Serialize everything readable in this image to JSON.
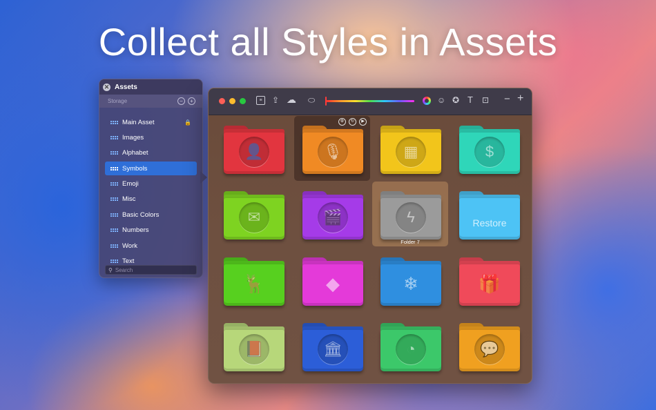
{
  "headline": "Collect all Styles in Assets",
  "assets_panel": {
    "title": "Assets",
    "storage_label": "Storage",
    "items": [
      {
        "label": "Main Asset",
        "locked": true
      },
      {
        "label": "Images"
      },
      {
        "label": "Alphabet"
      },
      {
        "label": "Symbols",
        "selected": true
      },
      {
        "label": "Emoji"
      },
      {
        "label": "Misc"
      },
      {
        "label": "Basic Colors"
      },
      {
        "label": "Numbers"
      },
      {
        "label": "Work"
      },
      {
        "label": "Text"
      }
    ],
    "search_placeholder": "Search"
  },
  "toolbar": {
    "icons": [
      "notes-icon",
      "share-icon",
      "cloud-icon",
      "tag-icon",
      "hue-slider",
      "color-wheel-icon",
      "emoji-icon",
      "star-icon",
      "text-icon",
      "image-icon",
      "minus-icon",
      "plus-icon"
    ]
  },
  "colors": {
    "accent": "#2f6fd8",
    "traffic_red": "#ff5f57",
    "traffic_yellow": "#febc2e",
    "traffic_green": "#28c840"
  },
  "folders": [
    {
      "color": "#e2353f",
      "icon": "person-icon",
      "glyph": "👤"
    },
    {
      "color": "#f08a24",
      "icon": "microphone-icon",
      "glyph": "🎙",
      "hover": true
    },
    {
      "color": "#f2c51b",
      "icon": "phone-booth-icon",
      "glyph": "▦"
    },
    {
      "color": "#2fd6b9",
      "icon": "money-icon",
      "glyph": "$"
    },
    {
      "color": "#7ed321",
      "icon": "mail-icon",
      "glyph": "✉"
    },
    {
      "color": "#a53be8",
      "icon": "clapperboard-icon",
      "glyph": "🎬"
    },
    {
      "color": "#9b9b9b",
      "icon": "lightning-icon",
      "glyph": "ϟ",
      "selected": true,
      "caption": "Folder 7"
    },
    {
      "color": "#4dc3f5",
      "icon": "restore-text",
      "text": "Restore"
    },
    {
      "color": "#57d01f",
      "icon": "deer-icon",
      "glyph": "🦌",
      "plain": true
    },
    {
      "color": "#e43ad9",
      "icon": "diamond-icon",
      "glyph": "◆",
      "plain": true
    },
    {
      "color": "#2f8fe0",
      "icon": "snowflake-icon",
      "glyph": "❄",
      "plain": true
    },
    {
      "color": "#f04a5a",
      "icon": "gift-icon",
      "glyph": "🎁",
      "plain": true
    },
    {
      "color": "#b7d77a",
      "icon": "book-icon",
      "glyph": "📕"
    },
    {
      "color": "#2c5ed8",
      "icon": "bank-icon",
      "glyph": "🏛"
    },
    {
      "color": "#3cc86a",
      "icon": "pie-chart-icon",
      "glyph": "◔"
    },
    {
      "color": "#f0a020",
      "icon": "chat-icon",
      "glyph": "💬"
    }
  ]
}
